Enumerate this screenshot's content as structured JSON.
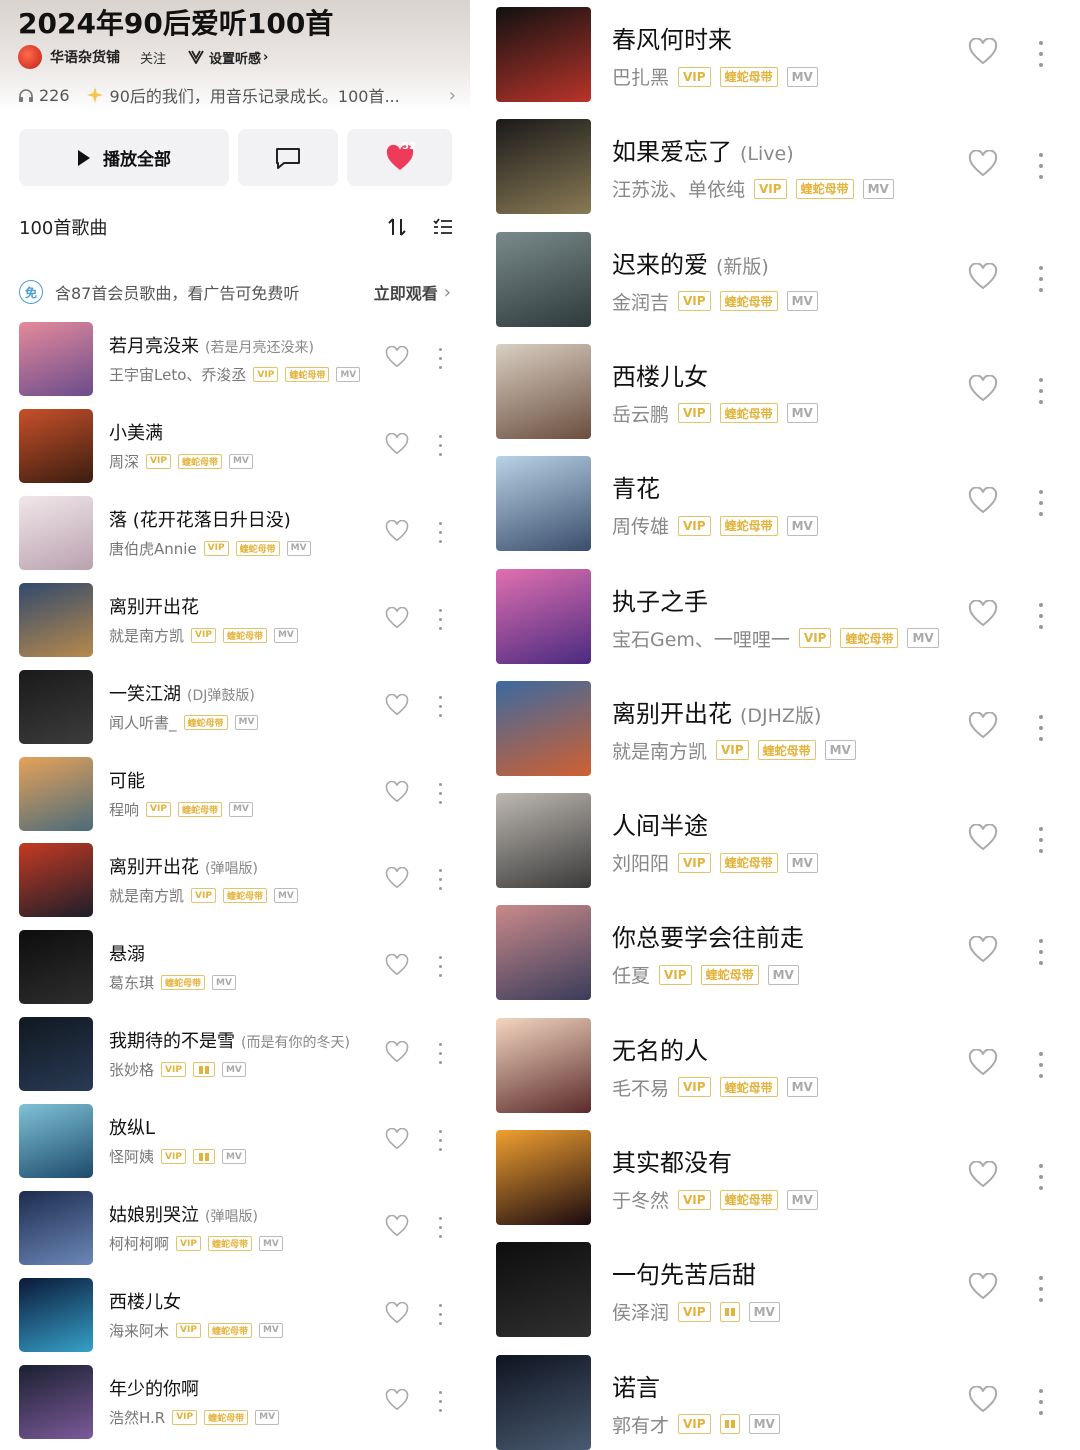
{
  "playlist": {
    "title": "2024年90后爱听100首",
    "owner": "华语杂货铺",
    "follow_label": "关注",
    "preferences_label": "设置听感",
    "listen_count": "226",
    "description": "90后的我们，用音乐记录成长。100首...",
    "play_all_label": "播放全部",
    "favorite_count": "52",
    "song_count_label": "100首歌曲",
    "promo_text": "含87首会员歌曲，看广告可免费听",
    "promo_action": "立即观看",
    "promo_badge": "免"
  },
  "tags": {
    "vip": "VIP",
    "dolby": "蝰蛇母带",
    "mv": "MV"
  },
  "left_songs": [
    {
      "title": "若月亮没来",
      "subtitle": "(若是月亮还没来)",
      "artist": "王宇宙Leto、乔浚丞",
      "dolby_icon": false,
      "vip": true
    },
    {
      "title": "小美满",
      "subtitle": "",
      "artist": "周深",
      "dolby_icon": false,
      "vip": true
    },
    {
      "title": "落 (花开花落日升日没)",
      "subtitle": "",
      "artist": "唐伯虎Annie",
      "dolby_icon": false,
      "vip": true
    },
    {
      "title": "离别开出花",
      "subtitle": "",
      "artist": "就是南方凯",
      "dolby_icon": false,
      "vip": true
    },
    {
      "title": "一笑江湖",
      "subtitle": "(DJ弹鼓版)",
      "artist": "闻人听書_",
      "dolby_icon": false,
      "vip": false
    },
    {
      "title": "可能",
      "subtitle": "",
      "artist": "程响",
      "dolby_icon": false,
      "vip": true
    },
    {
      "title": "离别开出花",
      "subtitle": "(弹唱版)",
      "artist": "就是南方凯",
      "dolby_icon": false,
      "vip": true
    },
    {
      "title": "悬溺",
      "subtitle": "",
      "artist": "葛东琪",
      "dolby_icon": false,
      "vip": false
    },
    {
      "title": "我期待的不是雪",
      "subtitle": "(而是有你的冬天)",
      "artist": "张妙格",
      "dolby_icon": true,
      "vip": true
    },
    {
      "title": "放纵L",
      "subtitle": "",
      "artist": "怪阿姨",
      "dolby_icon": true,
      "vip": true
    },
    {
      "title": "姑娘别哭泣",
      "subtitle": "(弹唱版)",
      "artist": "柯柯柯啊",
      "dolby_icon": false,
      "vip": true
    },
    {
      "title": "西楼儿女",
      "subtitle": "",
      "artist": "海来阿木",
      "dolby_icon": false,
      "vip": true
    },
    {
      "title": "年少的你啊",
      "subtitle": "",
      "artist": "浩然H.R",
      "dolby_icon": false,
      "vip": true
    }
  ],
  "right_songs": [
    {
      "title": "春风何时来",
      "subtitle": "",
      "artist": "巴扎黑",
      "dolby_icon": false,
      "vip": true
    },
    {
      "title": "如果爱忘了",
      "subtitle": "(Live)",
      "artist": "汪苏泷、单依纯",
      "dolby_icon": false,
      "vip": true
    },
    {
      "title": "迟来的爱",
      "subtitle": "(新版)",
      "artist": "金润吉",
      "dolby_icon": false,
      "vip": true
    },
    {
      "title": "西楼儿女",
      "subtitle": "",
      "artist": "岳云鹏",
      "dolby_icon": false,
      "vip": true
    },
    {
      "title": "青花",
      "subtitle": "",
      "artist": "周传雄",
      "dolby_icon": false,
      "vip": true
    },
    {
      "title": "执子之手",
      "subtitle": "",
      "artist": "宝石Gem、一哩哩一",
      "dolby_icon": false,
      "vip": true
    },
    {
      "title": "离别开出花",
      "subtitle": "(DJHZ版)",
      "artist": "就是南方凯",
      "dolby_icon": false,
      "vip": true
    },
    {
      "title": "人间半途",
      "subtitle": "",
      "artist": "刘阳阳",
      "dolby_icon": false,
      "vip": true
    },
    {
      "title": "你总要学会往前走",
      "subtitle": "",
      "artist": "任夏",
      "dolby_icon": false,
      "vip": true
    },
    {
      "title": "无名的人",
      "subtitle": "",
      "artist": "毛不易",
      "dolby_icon": false,
      "vip": true
    },
    {
      "title": "其实都没有",
      "subtitle": "",
      "artist": "于冬然",
      "dolby_icon": false,
      "vip": true
    },
    {
      "title": "一句先苦后甜",
      "subtitle": "",
      "artist": "侯泽润",
      "dolby_icon": true,
      "vip": true
    },
    {
      "title": "诺言",
      "subtitle": "",
      "artist": "郭有才",
      "dolby_icon": true,
      "vip": true
    }
  ],
  "left_covers": [
    "#e58a9b,#6a4c8c",
    "#c7502a,#3a1d10",
    "#f1e7ea,#b9a1ae",
    "#314a6e,#b8894c",
    "#1a1a1a,#3c3c3c",
    "#e6a259,#4a6b7a",
    "#c53a23,#1c1e2a",
    "#0d0d0d,#2e2e2e",
    "#101820,#2a3a55",
    "#7fc2d6,#1d4a6b",
    "#1c2c4e,#6c87b8",
    "#0a1838,#36a1c8",
    "#1a2030,#7b5a9a"
  ],
  "right_covers": [
    "#111,#b8342a",
    "#1a1a1a,#8a7a55",
    "#7a8a8a,#2e3a3c",
    "#d9cfc3,#6a4e3e",
    "#b9d3e6,#3a4d6b",
    "#e070b0,#4a2a80",
    "#3b6aa0,#d06030",
    "#bdb8b2,#3a3a3a",
    "#c98a8a,#3a3c5a",
    "#f3d6c0,#5a2a2a",
    "#f0a030,#1a0a10",
    "#0d0d0d,#303030",
    "#0e1420,#4a5a70"
  ]
}
